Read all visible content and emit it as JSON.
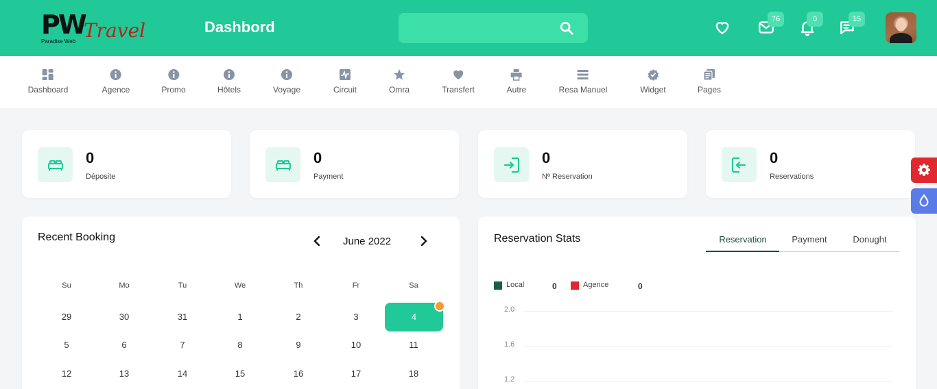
{
  "header": {
    "logo_initials": "PW",
    "logo_word": "Travel",
    "logo_sub": "Paradise Web",
    "title": "Dashbord",
    "search": {
      "placeholder": "",
      "icon": "search-icon"
    },
    "icons": [
      {
        "name": "favorites-icon",
        "badge": ""
      },
      {
        "name": "mail-icon",
        "badge": "76"
      },
      {
        "name": "bell-icon",
        "badge": "0"
      },
      {
        "name": "chat-icon",
        "badge": "15"
      }
    ],
    "accent": "#20c997"
  },
  "nav": [
    {
      "label": "Dashboard",
      "icon": "grid-icon"
    },
    {
      "label": "Agence",
      "icon": "info-icon"
    },
    {
      "label": "Promo",
      "icon": "info-icon"
    },
    {
      "label": "Hôtels",
      "icon": "info-icon"
    },
    {
      "label": "Voyage",
      "icon": "info-icon"
    },
    {
      "label": "Circuit",
      "icon": "pulse-icon"
    },
    {
      "label": "Omra",
      "icon": "star-icon"
    },
    {
      "label": "Transfert",
      "icon": "heart-icon"
    },
    {
      "label": "Autre",
      "icon": "printer-icon"
    },
    {
      "label": "Resa Manuel",
      "icon": "menu-icon"
    },
    {
      "label": "Widget",
      "icon": "badge-check-icon"
    },
    {
      "label": "Pages",
      "icon": "pages-icon"
    }
  ],
  "stats": [
    {
      "value": "0",
      "label": "Déposite",
      "icon": "bed-icon"
    },
    {
      "value": "0",
      "label": "Payment",
      "icon": "bed-icon"
    },
    {
      "value": "0",
      "label": "Nº Reservation",
      "icon": "login-icon"
    },
    {
      "value": "0",
      "label": "Reservations",
      "icon": "logout-icon"
    }
  ],
  "booking": {
    "title": "Recent Booking",
    "month": "June 2022",
    "weekdays": [
      "Su",
      "Mo",
      "Tu",
      "We",
      "Th",
      "Fr",
      "Sa"
    ],
    "weeks": [
      [
        "29",
        "30",
        "31",
        "1",
        "2",
        "3",
        "4"
      ],
      [
        "5",
        "6",
        "7",
        "8",
        "9",
        "10",
        "11"
      ],
      [
        "12",
        "13",
        "14",
        "15",
        "16",
        "17",
        "18"
      ]
    ],
    "selected": "4",
    "dot_color": "#f59b34"
  },
  "reservation_stats": {
    "title": "Reservation Stats",
    "tabs": [
      "Reservation",
      "Payment",
      "Donught"
    ],
    "active_tab": "Reservation",
    "legend": [
      {
        "label": "Local",
        "value": "0",
        "color": "#1b5e4a"
      },
      {
        "label": "Agence",
        "value": "0",
        "color": "#e0282e"
      }
    ]
  },
  "chart_data": {
    "type": "line",
    "series": [
      {
        "name": "Local",
        "values": []
      },
      {
        "name": "Agence",
        "values": []
      }
    ],
    "yticks": [
      "2.0",
      "1.6",
      "1.2"
    ],
    "grid": true
  },
  "side_buttons": [
    {
      "icon": "gear-icon",
      "color": "#e0282e"
    },
    {
      "icon": "drop-icon",
      "color": "#5b7be8"
    }
  ]
}
